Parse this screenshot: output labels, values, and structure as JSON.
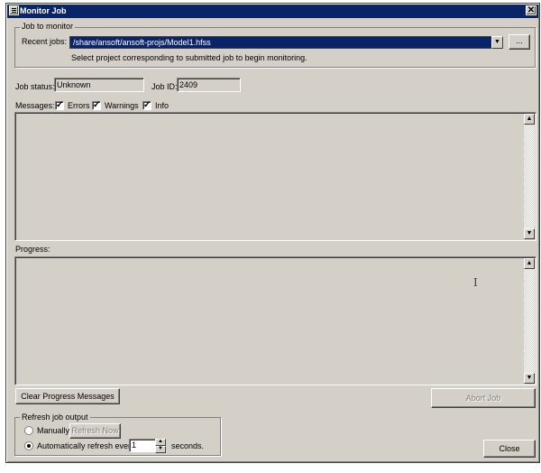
{
  "window": {
    "title": "Monitor Job",
    "close_glyph": "✕"
  },
  "job_group": {
    "legend": "Job to monitor",
    "recent_label": "Recent jobs:",
    "recent_value": "/share/ansoft/ansoft-projs/Model1.hfss",
    "browse_label": "...",
    "hint": "Select project corresponding to submitted job to begin monitoring."
  },
  "status": {
    "job_status_label": "Job status:",
    "job_status_value": "Unknown",
    "job_id_label": "Job ID:",
    "job_id_value": "2409"
  },
  "messages": {
    "label": "Messages:",
    "errors_label": "Errors",
    "warnings_label": "Warnings",
    "info_label": "Info",
    "check_glyph": "✓"
  },
  "progress": {
    "label": "Progress:"
  },
  "buttons": {
    "clear_progress": "Clear Progress Messages",
    "abort_job": "Abort Job",
    "close": "Close"
  },
  "refresh": {
    "legend": "Refresh job output",
    "manually_label": "Manually",
    "refresh_now": "Refresh Now",
    "auto_label": "Automatically refresh every",
    "interval_value": "1",
    "seconds_label": "seconds.",
    "selected": "automatic"
  },
  "icons": {
    "scroll_up": "▲",
    "scroll_down": "▼",
    "dropdown": "▼",
    "spin_up": "▲",
    "spin_down": "▼",
    "text_cursor": "I"
  }
}
